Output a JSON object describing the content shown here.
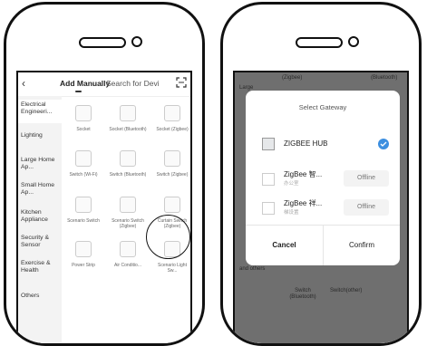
{
  "left_screen": {
    "back_glyph": "‹",
    "tab_active": "Add Manually",
    "tab_inactive": "Search for Devi",
    "sidebar": [
      {
        "label": "Electrical Engineeri...",
        "active": true
      },
      {
        "label": "Lighting"
      },
      {
        "label": "Large Home Ap..."
      },
      {
        "label": "Small Home Ap..."
      },
      {
        "label": "Kitchen Appliance"
      },
      {
        "label": "Security & Sensor"
      },
      {
        "label": "Exercise & Health"
      },
      {
        "label": "Others"
      }
    ],
    "devices": [
      {
        "label": "Socket"
      },
      {
        "label": "Socket (Bluetooth)"
      },
      {
        "label": "Socket (Zigbee)"
      },
      {
        "label": "Switch (Wi-Fi)"
      },
      {
        "label": "Switch (Bluetooth)"
      },
      {
        "label": "Switch (Zigbee)"
      },
      {
        "label": "Scenario Switch"
      },
      {
        "label": "Scenario Switch (Zigbee)"
      },
      {
        "label": "Curtain Switch (Zigbee)"
      },
      {
        "label": "Power Strip"
      },
      {
        "label": "Air Conditio..."
      },
      {
        "label": "Scenario Light Sw..."
      }
    ]
  },
  "right_screen": {
    "bg_texts": [
      "Large",
      "and others",
      "Switch (Bluetooth)",
      "Switch(other)",
      "(Zigbee)",
      "(Bluetooth)"
    ],
    "dialog": {
      "title": "Select Gateway",
      "gateways": [
        {
          "name": "ZIGBEE HUB",
          "sub": "",
          "status": "selected"
        },
        {
          "name": "ZigBee 智...",
          "sub": "办公室",
          "status": "Offline"
        },
        {
          "name": "ZigBee 祥...",
          "sub": "梯设置",
          "status": "Offline"
        }
      ],
      "cancel": "Cancel",
      "confirm": "Confirm"
    }
  },
  "colors": {
    "accent": "#3c8fe0",
    "phone_outline": "#111111",
    "overlay": "#6f6f6f"
  }
}
